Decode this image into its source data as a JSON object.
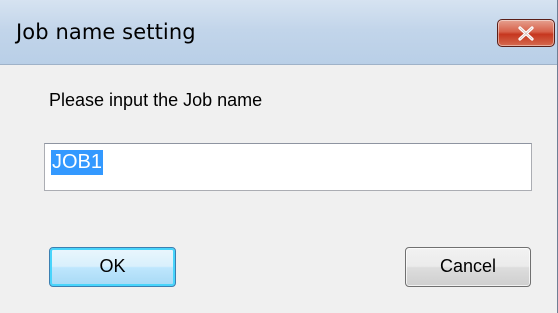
{
  "dialog": {
    "title": "Job name setting",
    "prompt": "Please input the Job name",
    "job_name_value": "JOB1",
    "ok_label": "OK",
    "cancel_label": "Cancel"
  },
  "icons": {
    "close": "close-icon"
  },
  "colors": {
    "close_button": "#c6371f",
    "selection_highlight": "#3399ff",
    "default_button_border": "#3c7fb1",
    "client_background": "#f0f0f0"
  }
}
